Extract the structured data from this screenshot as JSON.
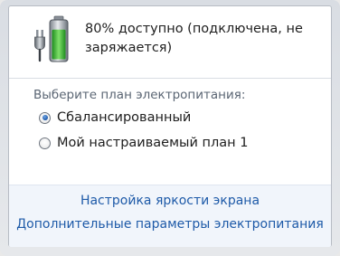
{
  "battery": {
    "status_line1": "80% доступно (подключена, не",
    "status_line2": "заряжается)",
    "charge_fraction": 0.8,
    "icon": "battery-plugged-icon"
  },
  "plans": {
    "heading": "Выберите план электропитания:",
    "options": [
      {
        "label": "Сбалансированный",
        "selected": true
      },
      {
        "label": "Мой настраиваемый план 1",
        "selected": false
      }
    ]
  },
  "links": {
    "brightness": "Настройка яркости экрана",
    "advanced": "Дополнительные параметры электропитания"
  },
  "colors": {
    "link": "#1e5aa8",
    "battery_fill": "#3cb43c",
    "radio_selected": "#1d57a8"
  }
}
